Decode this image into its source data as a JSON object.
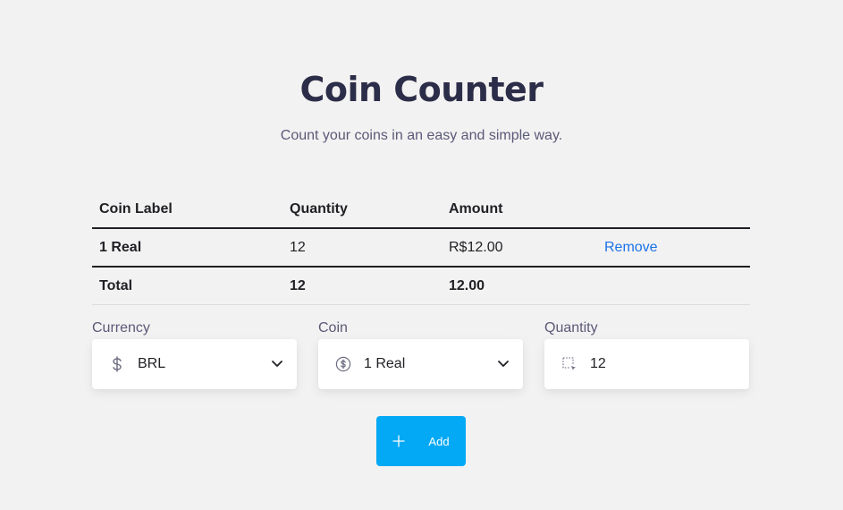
{
  "header": {
    "title": "Coin Counter",
    "subtitle": "Count your coins in an easy and simple way."
  },
  "table": {
    "columns": [
      "Coin Label",
      "Quantity",
      "Amount"
    ],
    "rows": [
      {
        "label": "1 Real",
        "quantity": "12",
        "amount": "R$12.00",
        "action": "Remove"
      }
    ],
    "total": {
      "label": "Total",
      "quantity": "12",
      "amount": "12.00"
    }
  },
  "form": {
    "currency": {
      "label": "Currency",
      "value": "BRL",
      "icon": "dollar-sign-icon"
    },
    "coin": {
      "label": "Coin",
      "value": "1 Real",
      "icon": "coin-icon"
    },
    "quantity": {
      "label": "Quantity",
      "value": "12",
      "icon": "select-icon"
    }
  },
  "add_button": {
    "label": "Add",
    "icon": "plus-icon"
  },
  "colors": {
    "background": "#f3f2f2",
    "title": "#2c2d48",
    "link": "#1a73e8",
    "accent": "#03a9f4"
  }
}
